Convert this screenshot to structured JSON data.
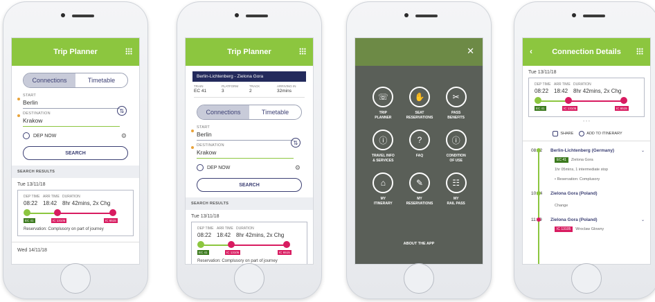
{
  "colors": {
    "brand_green": "#8cc63f",
    "accent_pink": "#d81b60",
    "navy": "#232a5c"
  },
  "phone1": {
    "title": "Trip Planner",
    "tabs": [
      "Connections",
      "Timetable"
    ],
    "start_label": "START",
    "start_value": "Berlin",
    "dest_label": "DESTINATION",
    "dest_value": "Krakow",
    "dep_now": "DEP NOW",
    "search": "SEARCH",
    "results_head": "SEARCH RESULTS",
    "date1": "Tue 13/11/18",
    "dep_time_label": "DEP TIME",
    "arr_time_label": "ARR TIME",
    "duration_label": "DURATION",
    "dep_time": "08:22",
    "arr_time": "18:42",
    "duration": "8hr 42mins, 2x Chg",
    "tag1": "EC 41",
    "tag2": "IC 13105",
    "tag3": "IC 6515",
    "reservation": "Reservation: Complusory on part of journey",
    "date2": "Wed 14/11/18"
  },
  "phone2": {
    "title": "Trip Planner",
    "route": "Berlin-Lichtenberg - Zielona Gora",
    "train_label": "TRAIN",
    "platform_label": "PLATFORM",
    "track_label": "TRACK",
    "arriving_label": "ARRIVING IN",
    "train": "EC 41",
    "platform": "3",
    "track": "2",
    "arriving": "32mins"
  },
  "phone3": {
    "items": [
      {
        "icon": "☏",
        "label": "TRIP\nPLANNER"
      },
      {
        "icon": "✋",
        "label": "SEAT\nRESERVATIONS"
      },
      {
        "icon": "✂",
        "label": "PASS\nBENEFITS"
      },
      {
        "icon": "ⓘ",
        "label": "TRAVEL INFO\n& SERVICES"
      },
      {
        "icon": "?",
        "label": "FAQ"
      },
      {
        "icon": "ⓘ",
        "label": "CONDITION\nOF USE"
      },
      {
        "icon": "⌂",
        "label": "MY\nITINERARY"
      },
      {
        "icon": "✎",
        "label": "MY\nRESERVATIONS"
      },
      {
        "icon": "☷",
        "label": "MY\nRAIL PASS"
      }
    ],
    "about": "ABOUT THE APP"
  },
  "phone4": {
    "title": "Connection Details",
    "date": "Tue 13/11/18",
    "share": "SHARE",
    "add": "ADD TO ITINERARY",
    "stop1_time": "08:22",
    "stop1_name": "Berlin-Lichtenberg (Germany)",
    "stop1_train": "EC 41",
    "stop1_dir": "Zielona Gora",
    "stop1_info": "1hr 05mins, 1 intermediate stop",
    "stop1_res": "• Reservation: Complusory",
    "stop2_time": "10:54",
    "stop2_name": "Zielona Gora (Poland)",
    "change": "Change",
    "stop3_time": "11:49",
    "stop3_name": "Zielona Gora (Poland)",
    "stop3_train": "IC 13105",
    "stop3_dir": "Wroclaw Glowny"
  }
}
